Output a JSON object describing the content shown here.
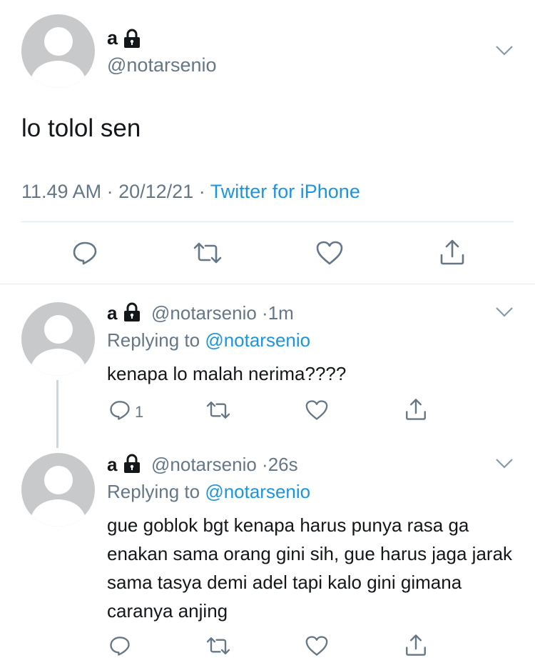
{
  "tweet": {
    "name": "a",
    "handle": "@notarsenio",
    "text": "lo tolol sen",
    "time": "11.49 AM",
    "date": "20/12/21",
    "source": "Twitter for iPhone"
  },
  "replies": [
    {
      "name": "a",
      "handle": "@notarsenio",
      "time_ago": "1m",
      "replying_label": "Replying to",
      "replying_to": "@notarsenio",
      "text": "kenapa lo malah nerima????",
      "reply_count": "1"
    },
    {
      "name": "a",
      "handle": "@notarsenio",
      "time_ago": "26s",
      "replying_label": "Replying to",
      "replying_to": "@notarsenio",
      "text": "gue goblok bgt kenapa harus punya rasa ga enakan sama orang gini sih, gue harus jaga jarak sama tasya demi adel tapi kalo gini gimana caranya anjing"
    }
  ],
  "separators": {
    "dot": "·"
  },
  "colors": {
    "link": "#1b95e0",
    "muted": "#657786",
    "text": "#14171a",
    "icon": "#657786",
    "avatar_bg": "#c8c9cb",
    "divider": "#e1e8ed"
  },
  "icons": [
    "lock-icon",
    "chevron-down-icon",
    "reply-icon",
    "retweet-icon",
    "like-icon",
    "share-icon"
  ]
}
